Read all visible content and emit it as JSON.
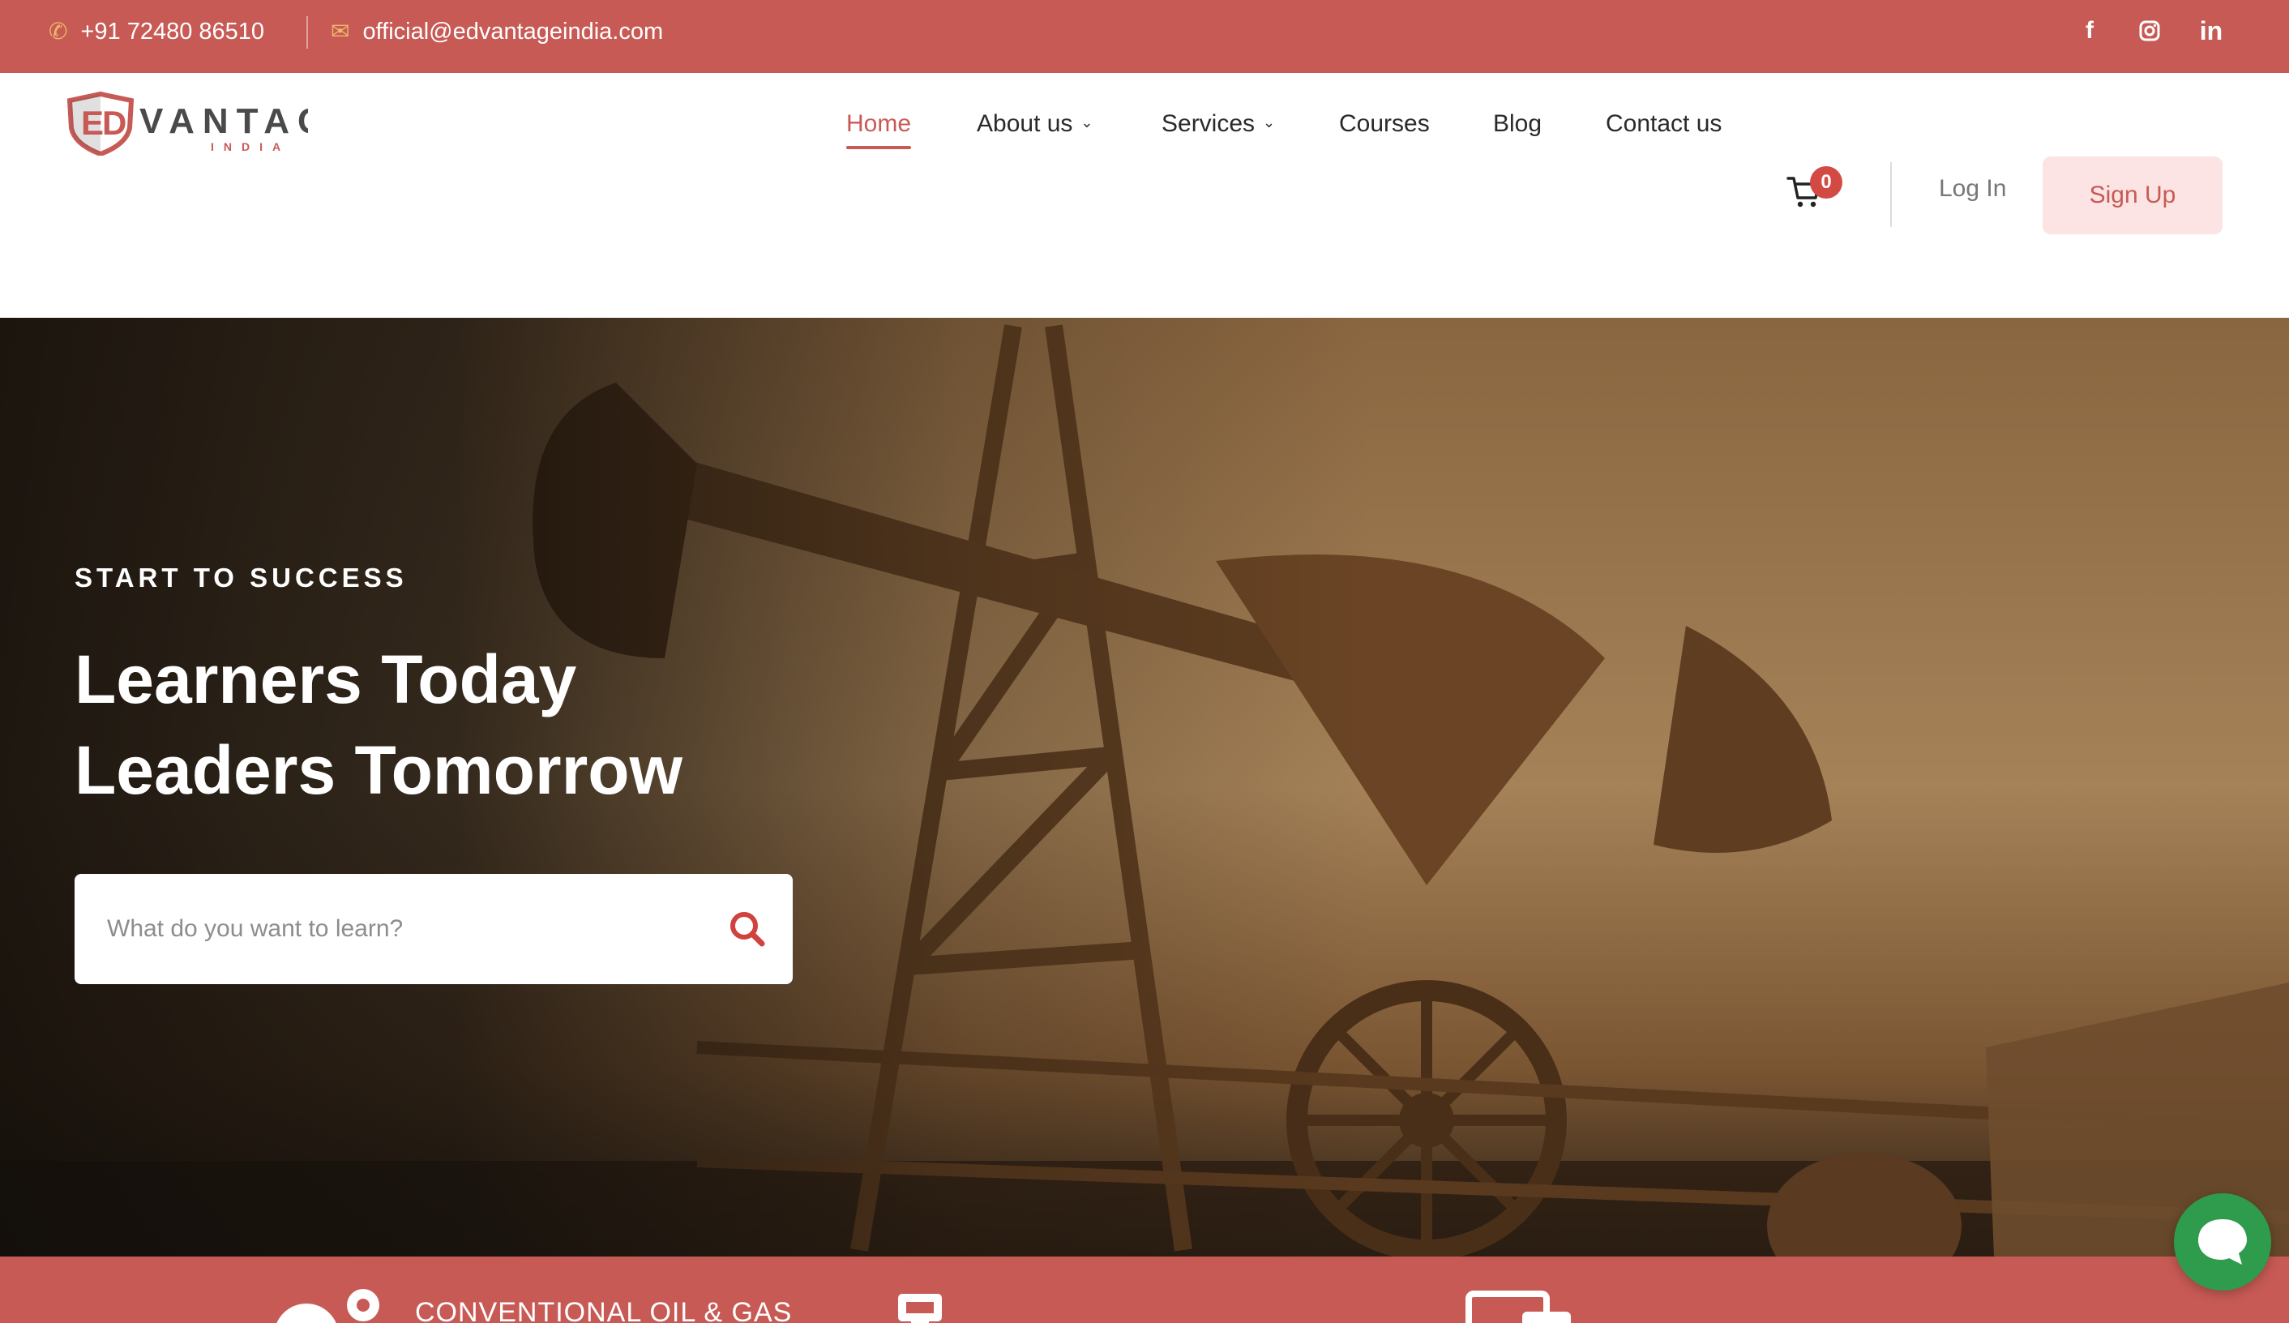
{
  "topbar": {
    "phone": "+91 72480 86510",
    "email": "official@edvantageindia.com",
    "social": [
      "facebook-icon",
      "instagram-icon",
      "linkedin-icon"
    ]
  },
  "logo": {
    "word": "VANTAGE",
    "sub": "INDIA",
    "mark": "ED"
  },
  "nav": {
    "items": [
      {
        "label": "Home"
      },
      {
        "label": "About us"
      },
      {
        "label": "Services"
      },
      {
        "label": "Courses"
      },
      {
        "label": "Blog"
      },
      {
        "label": "Contact us"
      }
    ],
    "cart_count": "0",
    "login": "Log In",
    "signup": "Sign Up"
  },
  "hero": {
    "eyebrow": "START TO SUCCESS",
    "line1": "Learners Today",
    "line2": "Leaders Tomorrow",
    "search_placeholder": "What do you want to learn?"
  },
  "strip": {
    "label1": "CONVENTIONAL OIL & GAS"
  },
  "colors": {
    "brand": "#c85a55",
    "accent": "#ecb86a",
    "chat": "#2f9b4c",
    "signup_bg": "#fbe4e3"
  }
}
